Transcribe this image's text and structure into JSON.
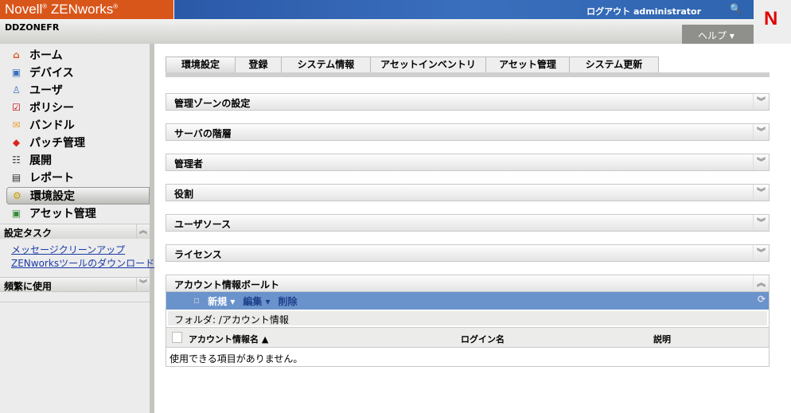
{
  "header": {
    "brand": "Novell",
    "brand_reg": "®",
    "product": "ZENworks",
    "logout": "ログアウト administrator",
    "zone": "DDZONEFR",
    "help": "ヘルプ ▾",
    "logo": "N"
  },
  "sidebar": {
    "items": [
      {
        "label": "ホーム",
        "icon": "home-icon"
      },
      {
        "label": "デバイス",
        "icon": "monitor-icon"
      },
      {
        "label": "ユーザ",
        "icon": "user-icon"
      },
      {
        "label": "ポリシー",
        "icon": "policy-icon"
      },
      {
        "label": "バンドル",
        "icon": "bundle-icon"
      },
      {
        "label": "パッチ管理",
        "icon": "patch-icon"
      },
      {
        "label": "展開",
        "icon": "deploy-icon"
      },
      {
        "label": "レポート",
        "icon": "report-icon"
      },
      {
        "label": "環境設定",
        "icon": "gear-icon"
      },
      {
        "label": "アセット管理",
        "icon": "asset-icon"
      }
    ],
    "tasks_title": "設定タスク",
    "tasks": [
      "メッセージクリーンアップ",
      "ZENworksツールのダウンロード"
    ],
    "frequent_title": "頻繁に使用"
  },
  "tabs": [
    "環境設定",
    "登録",
    "システム情報",
    "アセットインベントリ",
    "アセット管理",
    "システム更新"
  ],
  "panels": [
    "管理ゾーンの設定",
    "サーバの階層",
    "管理者",
    "役割",
    "ユーザソース",
    "ライセンス"
  ],
  "vault": {
    "title": "アカウント情報ボールト",
    "new": "新規 ▾",
    "edit": "編集 ▾",
    "delete": "削除",
    "folder": "フォルダ: /アカウント情報",
    "columns": [
      "アカウント情報名 ▲",
      "ログイン名",
      "説明"
    ],
    "empty": "使用できる項目がありません。"
  }
}
